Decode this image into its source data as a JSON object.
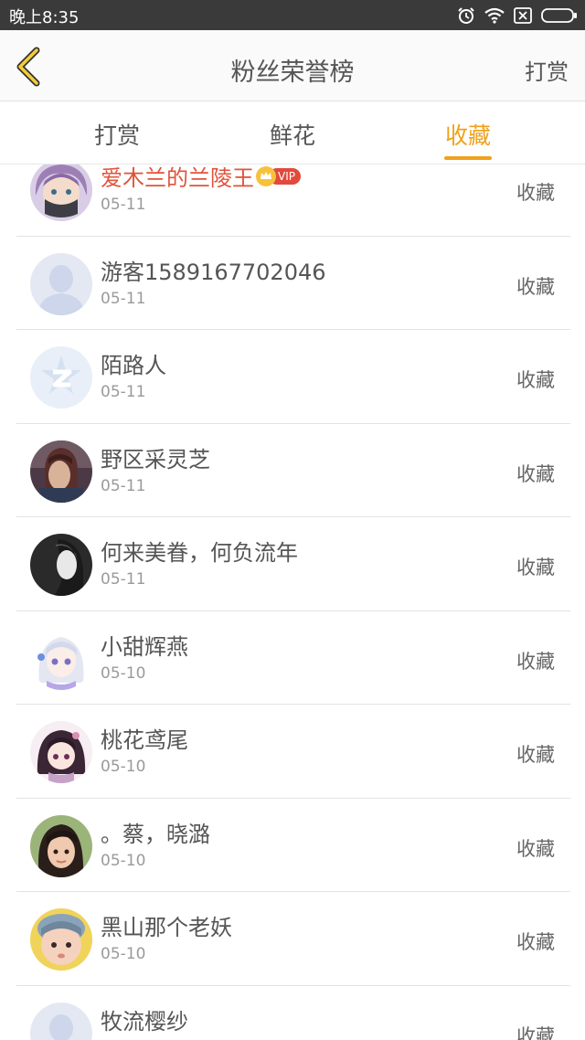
{
  "status_bar": {
    "time": "晚上8:35"
  },
  "nav": {
    "title": "粉丝荣誉榜",
    "action": "打赏"
  },
  "tabs": [
    {
      "label": "打赏",
      "active": false
    },
    {
      "label": "鲜花",
      "active": false
    },
    {
      "label": "收藏",
      "active": true
    }
  ],
  "accent_color": "#f0a11d",
  "vip_badge": "VIP",
  "list": [
    {
      "name": "爱木兰的兰陵王",
      "date": "05-11",
      "action": "收藏",
      "vip": true,
      "avatar": "purple-hair-masked-avatar"
    },
    {
      "name": "游客1589167702046",
      "date": "05-11",
      "action": "收藏",
      "vip": false,
      "avatar": "default-user-avatar"
    },
    {
      "name": "陌路人",
      "date": "05-11",
      "action": "收藏",
      "vip": false,
      "avatar": "qq-logo-avatar"
    },
    {
      "name": "野区采灵芝",
      "date": "05-11",
      "action": "收藏",
      "vip": false,
      "avatar": "game-character-avatar"
    },
    {
      "name": "何来美眷，何负流年",
      "date": "05-11",
      "action": "收藏",
      "vip": false,
      "avatar": "monochrome-portrait-avatar"
    },
    {
      "name": "小甜辉燕",
      "date": "05-10",
      "action": "收藏",
      "vip": false,
      "avatar": "anime-girl-avatar"
    },
    {
      "name": "桃花鸢尾",
      "date": "05-10",
      "action": "收藏",
      "vip": false,
      "avatar": "chibi-girl-avatar"
    },
    {
      "name": "。蔡，晓潞",
      "date": "05-10",
      "action": "收藏",
      "vip": false,
      "avatar": "selfie-avatar"
    },
    {
      "name": "黑山那个老妖",
      "date": "05-10",
      "action": "收藏",
      "vip": false,
      "avatar": "baby-photo-avatar"
    },
    {
      "name": "牧流樱纱",
      "date": "",
      "action": "收藏",
      "vip": false,
      "avatar": "default-user-avatar"
    }
  ]
}
